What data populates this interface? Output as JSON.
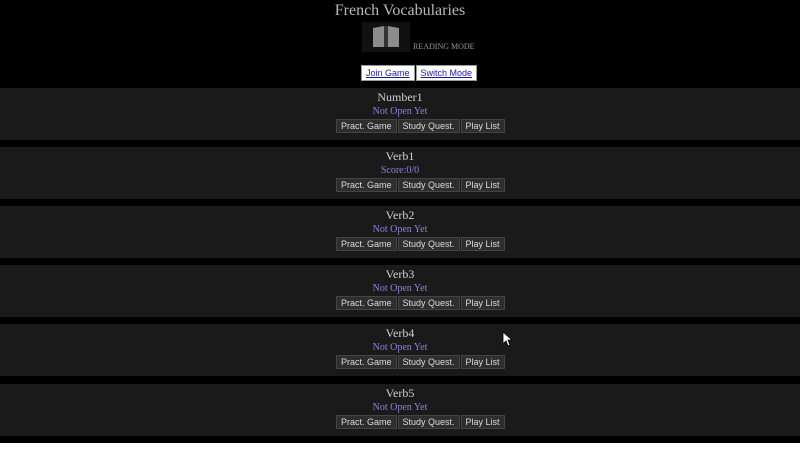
{
  "header": {
    "title": "French Vocabularies",
    "mode_icon": "open-book-icon",
    "mode_label": "READING MODE",
    "join_label": "Join Game",
    "switch_label": "Switch Mode"
  },
  "buttons": {
    "pract": "Pract. Game",
    "study": "Study Quest.",
    "play": "Play List"
  },
  "sets": [
    {
      "name": "Number1",
      "status": "Not Open Yet"
    },
    {
      "name": "Verb1",
      "status": "Score:0/0"
    },
    {
      "name": "Verb2",
      "status": "Not Open Yet"
    },
    {
      "name": "Verb3",
      "status": "Not Open Yet"
    },
    {
      "name": "Verb4",
      "status": "Not Open Yet"
    },
    {
      "name": "Verb5",
      "status": "Not Open Yet"
    }
  ],
  "colors": {
    "background": "#000000",
    "panel": "#1a1a1a",
    "status_text": "#8b84d6",
    "link": "#1a1aa0"
  }
}
